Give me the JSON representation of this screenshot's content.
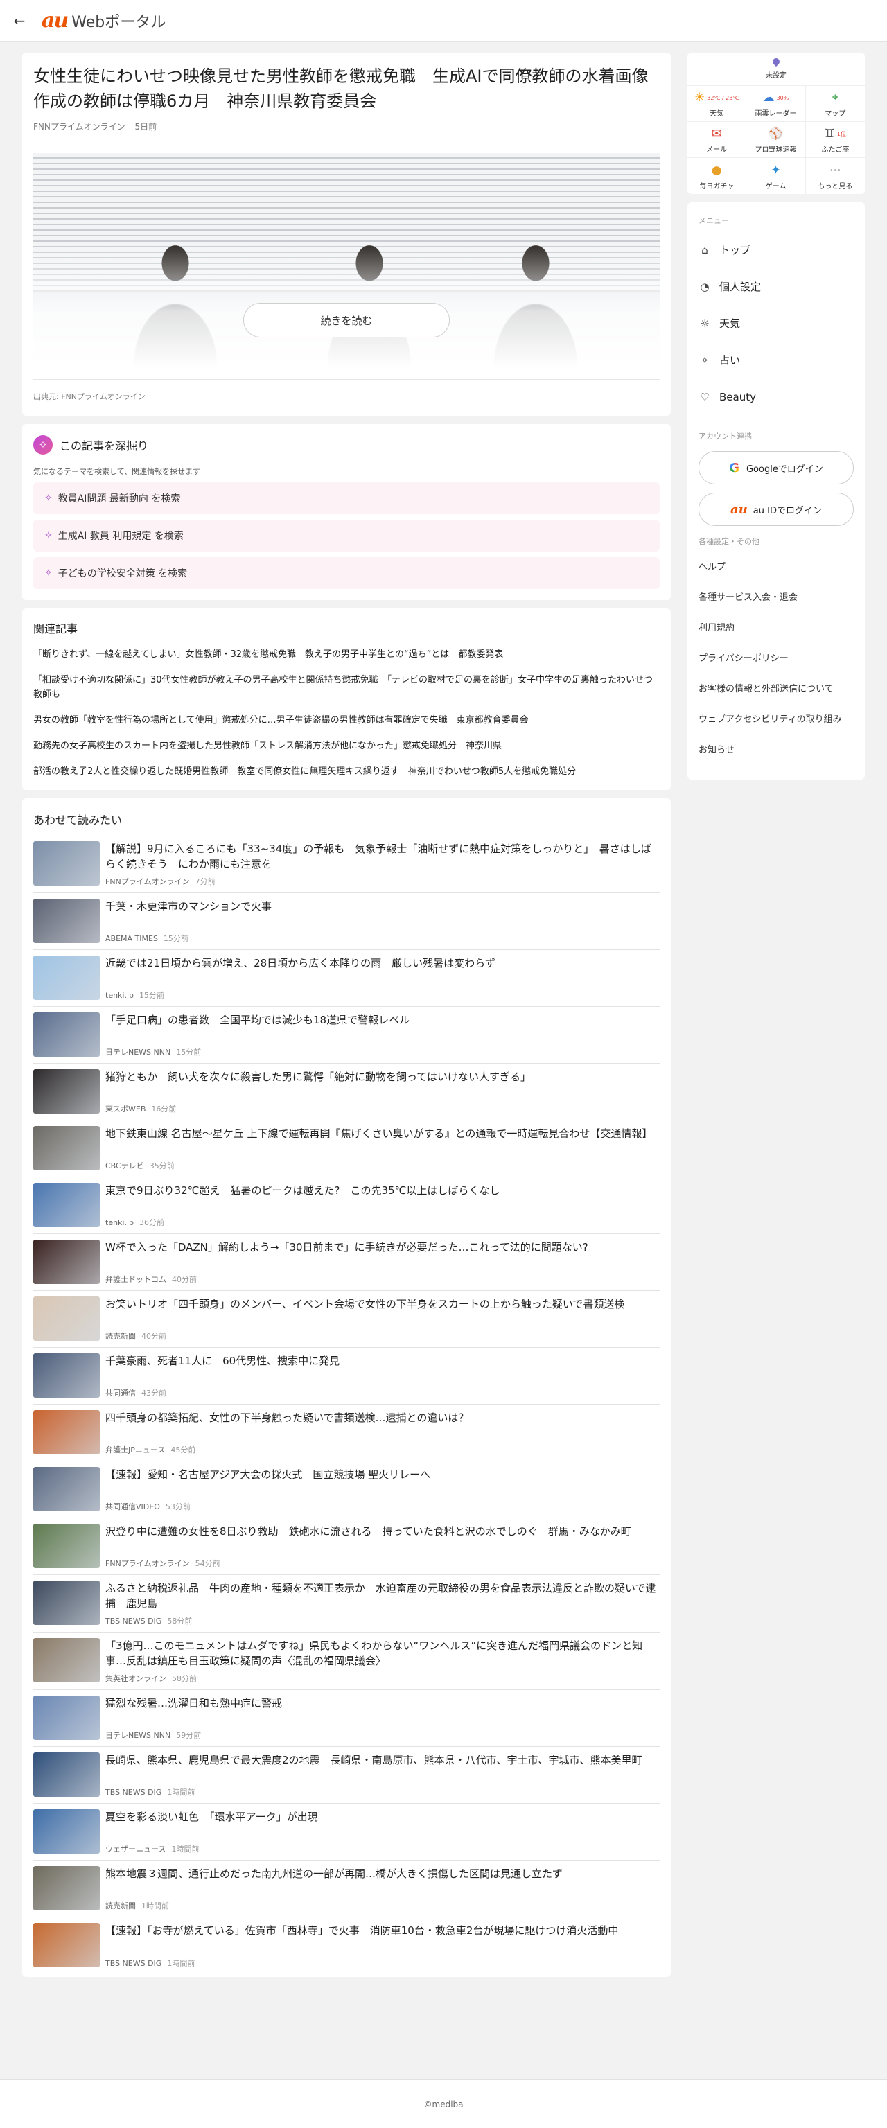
{
  "header": {
    "back_icon": "back-arrow-icon",
    "brand_au": "au",
    "brand_web": "Webポータル"
  },
  "article": {
    "title": "女性生徒にわいせつ映像見せた男性教師を懲戒免職　生成AIで同僚教師の水着画像作成の教師は停職6カ月　神奈川県教育委員会",
    "source": "FNNプライムオンライン",
    "time": "5日前",
    "read_more": "続きを読む",
    "credit": "出典元: FNNプライムオンライン"
  },
  "deep_dive": {
    "title": "この記事を深掘り",
    "subtitle": "気になるテーマを検索して、関連情報を探せます",
    "items": [
      "教員AI問題 最新動向 を検索",
      "生成AI 教員 利用規定 を検索",
      "子どもの学校安全対策 を検索"
    ]
  },
  "related": {
    "title": "関連記事",
    "items": [
      "「断りきれず、一線を越えてしまい」女性教師・32歳を懲戒免職　教え子の男子中学生との“過ち”とは　都教委発表",
      "「相談受け不適切な関係に」30代女性教師が教え子の男子高校生と関係持ち懲戒免職　「テレビの取材で足の裏を診断」女子中学生の足裏触ったわいせつ教師も",
      "男女の教師「教室を性行為の場所として使用」懲戒処分に…男子生徒盗撮の男性教師は有罪確定で失職　東京都教育委員会",
      "勤務先の女子高校生のスカート内を盗撮した男性教師「ストレス解消方法が他になかった」懲戒免職処分　神奈川県",
      "部活の教え子2人と性交繰り返した既婚男性教師　教室で同僚女性に無理矢理キス繰り返す　神奈川でわいせつ教師5人を懲戒免職処分"
    ]
  },
  "recommended": {
    "title": "あわせて読みたい",
    "items": [
      {
        "title": "【解説】9月に入るころにも「33~34度」の予報も　気象予報士「油断せずに熱中症対策をしっかりと」　暑さはしばらく続きそう　にわか雨にも注意を",
        "source": "FNNプライムオンライン",
        "time": "7分前",
        "thumb": "#7c8fa8"
      },
      {
        "title": "千葉・木更津市のマンションで火事",
        "source": "ABEMA TIMES",
        "time": "15分前",
        "thumb": "#5d6273"
      },
      {
        "title": "近畿では21日頃から雲が増え、28日頃から広く本降りの雨　厳しい残暑は変わらず",
        "source": "tenki.jp",
        "time": "15分前",
        "thumb": "#9fc4e4"
      },
      {
        "title": "「手足口病」の患者数　全国平均では減少も18道県で警報レベル",
        "source": "日テレNEWS NNN",
        "time": "15分前",
        "thumb": "#5a6d8e"
      },
      {
        "title": "猪狩ともか　飼い犬を次々に殺害した男に驚愕「絶対に動物を飼ってはいけない人すぎる」",
        "source": "東スポWEB",
        "time": "16分前",
        "thumb": "#2d2a2b"
      },
      {
        "title": "地下鉄東山線 名古屋～星ケ丘 上下線で運転再開『焦げくさい臭いがする』との通報で一時運転見合わせ【交通情報】",
        "source": "CBCテレビ",
        "time": "35分前",
        "thumb": "#6d6a64"
      },
      {
        "title": "東京で9日ぶり32℃超え　猛暑のピークは越えた?　この先35℃以上はしばらくなし",
        "source": "tenki.jp",
        "time": "36分前",
        "thumb": "#4a76b0"
      },
      {
        "title": "W杯で入った「DAZN」解約しよう→「30日前まで」に手続きが必要だった…これって法的に問題ない?",
        "source": "弁護士ドットコム",
        "time": "40分前",
        "thumb": "#3a2220"
      },
      {
        "title": "お笑いトリオ「四千頭身」のメンバー、イベント会場で女性の下半身をスカートの上から触った疑いで書類送検",
        "source": "読売新聞",
        "time": "40分前",
        "thumb": "#d9c7b5"
      },
      {
        "title": "千葉豪雨、死者11人に　60代男性、捜索中に発見",
        "source": "共同通信",
        "time": "43分前",
        "thumb": "#4c5d7a"
      },
      {
        "title": "四千頭身の都築拓紀、女性の下半身触った疑いで書類送検…逮捕との違いは？",
        "source": "弁護士JPニュース",
        "time": "45分前",
        "thumb": "#c9632f"
      },
      {
        "title": "【速報】愛知・名古屋アジア大会の採火式　国立競技場 聖火リレーへ",
        "source": "共同通信VIDEO",
        "time": "53分前",
        "thumb": "#5b6a83"
      },
      {
        "title": "沢登り中に遭難の女性を8日ぶり救助　鉄砲水に流される　持っていた食料と沢の水でしのぐ　群馬・みなかみ町",
        "source": "FNNプライムオンライン",
        "time": "54分前",
        "thumb": "#5e7a4e"
      },
      {
        "title": "ふるさと納税返礼品　牛肉の産地・種類を不適正表示か　水迫畜産の元取締役の男を食品表示法違反と詐欺の疑いで逮捕　鹿児島",
        "source": "TBS NEWS DIG",
        "time": "58分前",
        "thumb": "#3d4a5e"
      },
      {
        "title": "「3億円…このモニュメントはムダですね」県民もよくわからない“ワンヘルス”に突き進んだ福岡県議会のドンと知事…反乱は鎮圧も目玉政策に疑問の声〈混乱の福岡県議会〉",
        "source": "集英社オンライン",
        "time": "58分前",
        "thumb": "#8a7a66"
      },
      {
        "title": "猛烈な残暑…洗濯日和も熱中症に警戒",
        "source": "日テレNEWS NNN",
        "time": "59分前",
        "thumb": "#6a87b4"
      },
      {
        "title": "長崎県、熊本県、鹿児島県で最大震度2の地震　長崎県・南島原市、熊本県・八代市、宇土市、宇城市、熊本美里町",
        "source": "TBS NEWS DIG",
        "time": "1時間前",
        "thumb": "#2f4f7a"
      },
      {
        "title": "夏空を彩る淡い虹色　「環水平アーク」が出現",
        "source": "ウェザーニュース",
        "time": "1時間前",
        "thumb": "#3f6ea8"
      },
      {
        "title": "熊本地震３週間、通行止めだった南九州道の一部が再開…橋が大きく損傷した区間は見通し立たず",
        "source": "読売新聞",
        "time": "1時間前",
        "thumb": "#6e6a5c"
      },
      {
        "title": "【速報】「お寺が燃えている」佐賀市「西林寺」で火事　消防車10台・救急車2台が現場に駆けつけ消火活動中",
        "source": "TBS NEWS DIG",
        "time": "1時間前",
        "thumb": "#c66a30"
      }
    ]
  },
  "widget": {
    "location": "未設定",
    "items": [
      {
        "label": "天気",
        "icon": "sun-icon",
        "glyph": "☀",
        "color": "#f39800",
        "sub": "32℃ / 23℃"
      },
      {
        "label": "雨雲レーダー",
        "icon": "radar-icon",
        "glyph": "☁",
        "color": "#3a7fd5",
        "sub": "30%"
      },
      {
        "label": "マップ",
        "icon": "map-icon",
        "glyph": "⌖",
        "color": "#3aa04a",
        "sub": ""
      },
      {
        "label": "メール",
        "icon": "mail-icon",
        "glyph": "✉",
        "color": "#e0483c",
        "sub": ""
      },
      {
        "label": "プロ野球速報",
        "icon": "baseball-icon",
        "glyph": "⚾",
        "color": "#e05a2b",
        "sub": ""
      },
      {
        "label": "ふたご座",
        "icon": "zodiac-icon",
        "glyph": "♊",
        "color": "#555555",
        "sub": "1位"
      },
      {
        "label": "毎日ガチャ",
        "icon": "gacha-icon",
        "glyph": "●",
        "color": "#e8a128",
        "sub": ""
      },
      {
        "label": "ゲーム",
        "icon": "game-icon",
        "glyph": "✦",
        "color": "#2a8bd6",
        "sub": ""
      },
      {
        "label": "もっと見る",
        "icon": "more-icon",
        "glyph": "⋯",
        "color": "#777777",
        "sub": ""
      }
    ]
  },
  "menu": {
    "caption": "メニュー",
    "items": [
      {
        "label": "トップ",
        "icon": "home-icon",
        "glyph": "⌂"
      },
      {
        "label": "個人設定",
        "icon": "person-icon",
        "glyph": "◔"
      },
      {
        "label": "天気",
        "icon": "sun-icon",
        "glyph": "☼"
      },
      {
        "label": "占い",
        "icon": "sparkle-icon",
        "glyph": "✧"
      },
      {
        "label": "Beauty",
        "icon": "heart-icon",
        "glyph": "♡"
      }
    ],
    "account_caption": "アカウント連携",
    "google_login": "Googleでログイン",
    "google_mark": "G",
    "au_login": "au IDでログイン",
    "au_mark": "au",
    "other_caption": "各種設定・その他",
    "others": [
      "ヘルプ",
      "各種サービス入会・退会",
      "利用規約",
      "プライバシーポリシー",
      "お客様の情報と外部送信について",
      "ウェブアクセシビリティの取り組み",
      "お知らせ"
    ]
  },
  "footer": {
    "copyright": "©mediba"
  }
}
